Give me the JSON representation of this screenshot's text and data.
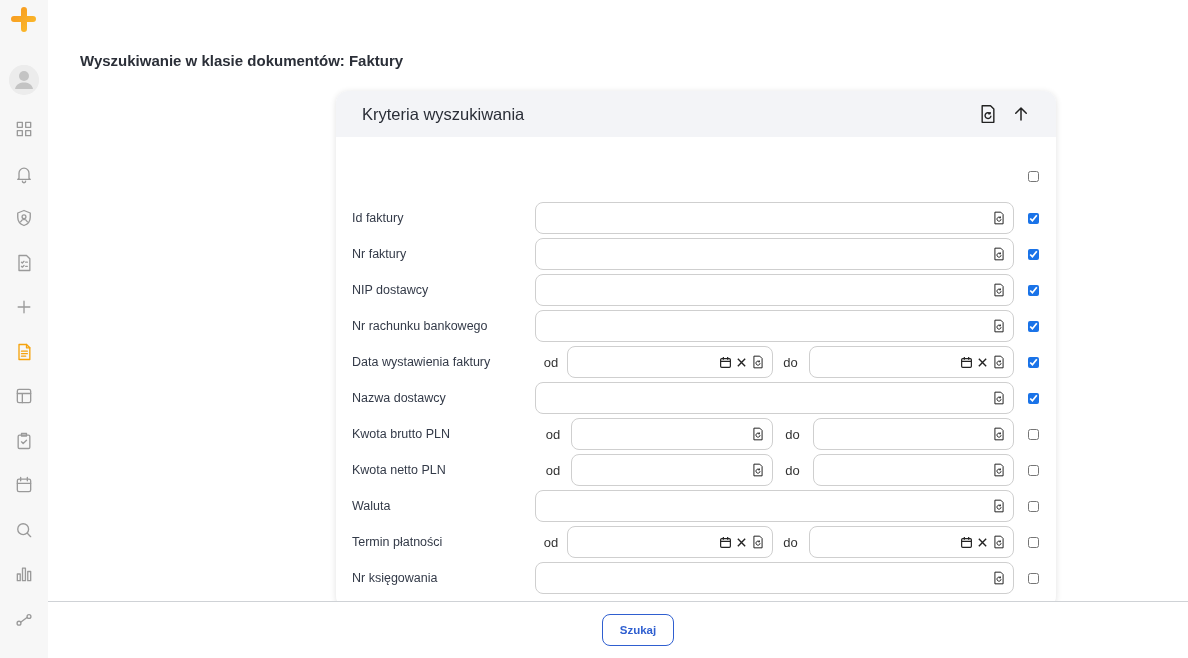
{
  "sidebar": {
    "items": [
      {
        "selected": false
      },
      {
        "selected": false
      },
      {
        "selected": false
      },
      {
        "selected": false
      },
      {
        "selected": false
      },
      {
        "selected": true
      },
      {
        "selected": false
      },
      {
        "selected": false
      },
      {
        "selected": false
      },
      {
        "selected": false
      },
      {
        "selected": false
      },
      {
        "selected": false
      }
    ]
  },
  "page_title": "Wyszukiwanie w klasie dokumentów: Faktury",
  "criteria": {
    "title": "Kryteria wyszukiwania",
    "select_all_checked": false,
    "rows": [
      {
        "kind": "text",
        "label": "Id faktury",
        "checked": true
      },
      {
        "kind": "text",
        "label": "Nr faktury",
        "checked": true
      },
      {
        "kind": "text",
        "label": "NIP dostawcy",
        "checked": true
      },
      {
        "kind": "text",
        "label": "Nr rachunku bankowego",
        "checked": true
      },
      {
        "kind": "date_range",
        "label": "Data wystawienia faktury",
        "from": "od",
        "to": "do",
        "checked": true
      },
      {
        "kind": "text",
        "label": "Nazwa dostawcy",
        "checked": true
      },
      {
        "kind": "number_range",
        "label": "Kwota brutto PLN",
        "from": "od",
        "to": "do",
        "checked": false
      },
      {
        "kind": "number_range",
        "label": "Kwota netto PLN",
        "from": "od",
        "to": "do",
        "checked": false
      },
      {
        "kind": "text",
        "label": "Waluta",
        "checked": false
      },
      {
        "kind": "date_range",
        "label": "Termin płatności",
        "from": "od",
        "to": "do",
        "checked": false
      },
      {
        "kind": "text",
        "label": "Nr księgowania",
        "checked": false
      }
    ]
  },
  "search_button": "Szukaj"
}
